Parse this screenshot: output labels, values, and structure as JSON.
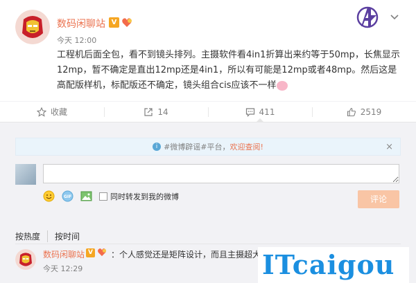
{
  "post": {
    "author": "数码闲聊站",
    "vip_badge": "V",
    "time": "今天 12:00",
    "text": "工程机后面全包，看不到镜头排列。主摄软件看4in1折算出来约等于50mp，长焦显示12mp，暂不确定是直出12mp还是4in1，所以有可能是12mp或者48mp。然后这是高配版样机，标配版还不确定，镜头组合cis应该不一样"
  },
  "actions": {
    "favorite_label": "收藏",
    "repost_count": "14",
    "comment_count": "411",
    "like_count": "2519"
  },
  "comments": {
    "notice_text": "#微博辟谣#平台，",
    "notice_highlight": "欢迎查阅!",
    "notice_close": "×",
    "input_value": "",
    "repost_checkbox_label": "同时转发到我的微博",
    "submit_label": "评论",
    "sort_hot": "按热度",
    "sort_time": "按时间",
    "items": [
      {
        "author": "数码闲聊站",
        "vip_badge": "V",
        "text": "：个人感觉还是矩阵设计，而且主摄超大",
        "time": "今天 12:29"
      }
    ]
  },
  "watermark": {
    "text_main": "ITcaigou"
  },
  "colors": {
    "accent": "#eb7350",
    "link_blue": "#1b8fe0",
    "background_gray": "#f2f2f5",
    "submit_disabled": "#f9c5a5"
  },
  "icons": {
    "top_right": "avengers-icon",
    "menu": "chevron-down-icon",
    "favorite": "star-icon",
    "repost": "share-arrow-icon",
    "comment": "speech-bubble-icon",
    "like": "thumbs-up-icon"
  }
}
